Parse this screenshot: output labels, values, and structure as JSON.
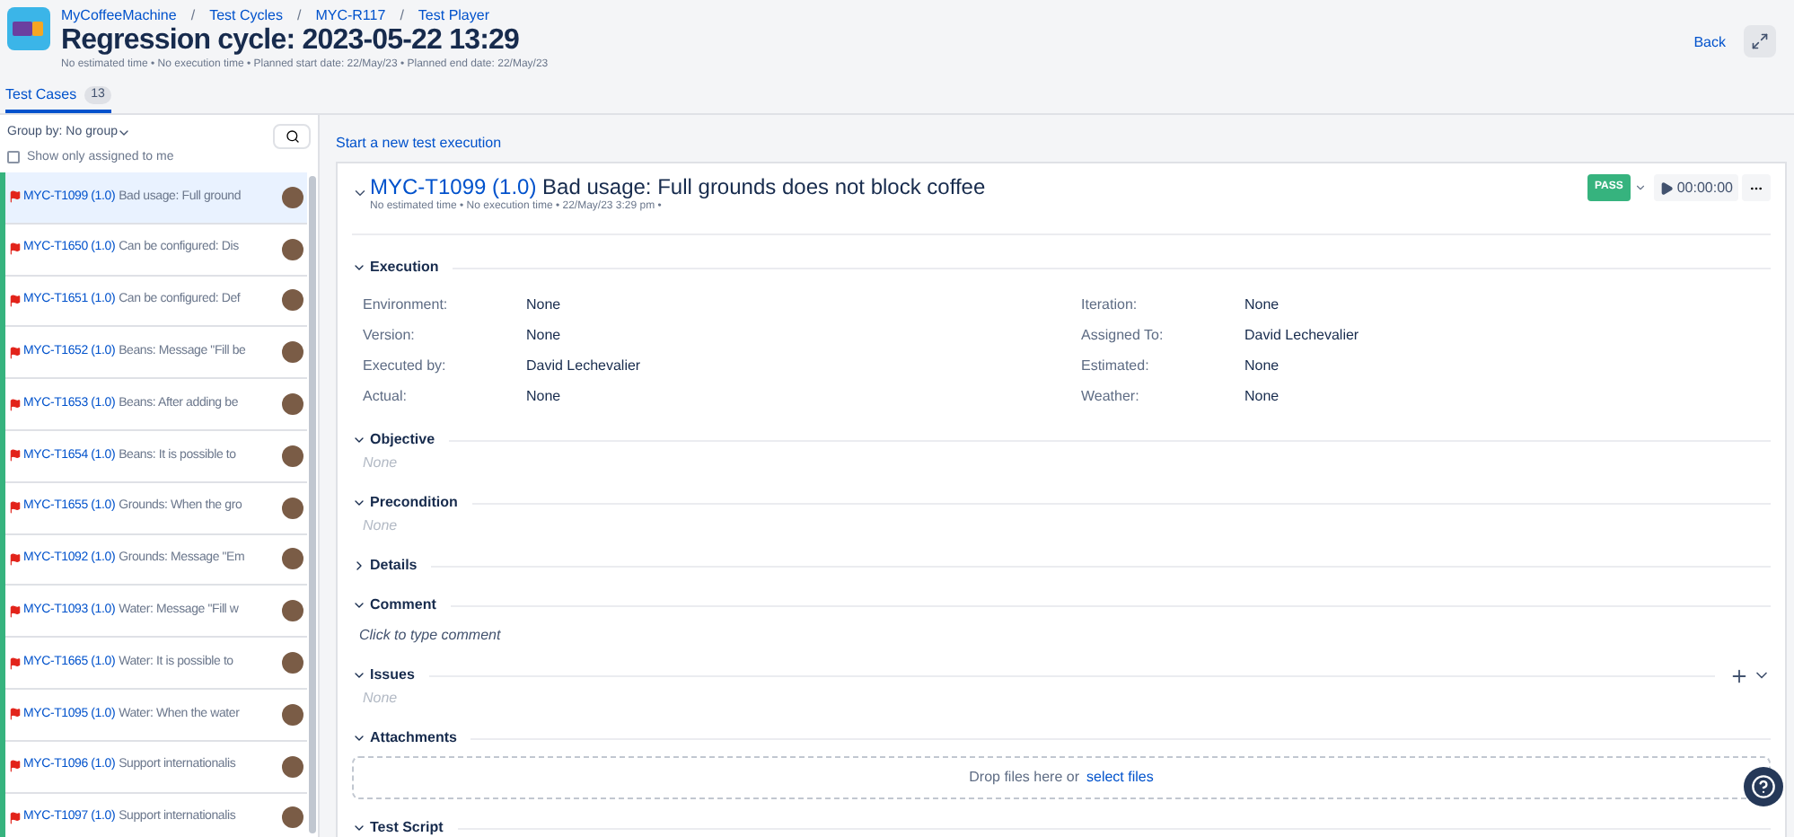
{
  "breadcrumbs": [
    "MyCoffeeMachine",
    "Test Cycles",
    "MYC-R117",
    "Test Player"
  ],
  "title": "Regression cycle: 2023-05-22 13:29",
  "breadcrumb_separator": "/",
  "meta": "No estimated time • No execution time • Planned start date: 22/May/23 • Planned end date: 22/May/23",
  "back": "Back",
  "tabs": [
    {
      "label": "Test Cases",
      "count": "13",
      "selected": true
    }
  ],
  "sidebar": {
    "group_by": "Group by: No group",
    "assigned_only": {
      "label": "Show only assigned to me",
      "checked": false
    },
    "items": [
      {
        "key": "MYC-T1099 (1.0)",
        "name": "Bad usage: Full ground",
        "selected": true
      },
      {
        "key": "MYC-T1650 (1.0)",
        "name": "Can be configured: Dis",
        "selected": false
      },
      {
        "key": "MYC-T1651 (1.0)",
        "name": "Can be configured: Def",
        "selected": false
      },
      {
        "key": "MYC-T1652 (1.0)",
        "name": "Beans: Message \"Fill be",
        "selected": false
      },
      {
        "key": "MYC-T1653 (1.0)",
        "name": "Beans: After adding be",
        "selected": false
      },
      {
        "key": "MYC-T1654 (1.0)",
        "name": "Beans: It is possible to",
        "selected": false
      },
      {
        "key": "MYC-T1655 (1.0)",
        "name": "Grounds: When the gro",
        "selected": false
      },
      {
        "key": "MYC-T1092 (1.0)",
        "name": "Grounds: Message \"Em",
        "selected": false
      },
      {
        "key": "MYC-T1093 (1.0)",
        "name": "Water: Message \"Fill w",
        "selected": false
      },
      {
        "key": "MYC-T1665 (1.0)",
        "name": "Water: It is possible to",
        "selected": false
      },
      {
        "key": "MYC-T1095 (1.0)",
        "name": "Water: When the water",
        "selected": false
      },
      {
        "key": "MYC-T1096 (1.0)",
        "name": "Support internationalis",
        "selected": false
      },
      {
        "key": "MYC-T1097 (1.0)",
        "name": "Support internationalis",
        "selected": false
      }
    ]
  },
  "new_execution": "Start a new test execution",
  "execution": {
    "key": "MYC-T1099 (1.0)",
    "name": "Bad usage: Full grounds does not block coffee",
    "meta": "No estimated time • No execution time • 22/May/23 3:29 pm •",
    "status": "PASS",
    "timer": "00:00:00",
    "sections": [
      {
        "kind": "fields",
        "title": "Execution",
        "expanded": true,
        "fields": [
          {
            "label": "Environment:",
            "value": "None"
          },
          {
            "label": "Iteration:",
            "value": "None"
          },
          {
            "label": "Version:",
            "value": "None"
          },
          {
            "label": "Assigned To:",
            "value": "David Lechevalier"
          },
          {
            "label": "Executed by:",
            "value": "David Lechevalier"
          },
          {
            "label": "Estimated:",
            "value": "None"
          },
          {
            "label": "Actual:",
            "value": "None"
          },
          {
            "label": "Weather:",
            "value": "None"
          }
        ]
      },
      {
        "kind": "empty",
        "title": "Objective",
        "expanded": true,
        "text": "None"
      },
      {
        "kind": "empty",
        "title": "Precondition",
        "expanded": true,
        "text": "None"
      },
      {
        "kind": "empty",
        "title": "Details",
        "expanded": false
      },
      {
        "kind": "comment",
        "title": "Comment",
        "expanded": true,
        "text": "Click to type comment"
      },
      {
        "kind": "issues",
        "title": "Issues",
        "expanded": true,
        "text": "None"
      },
      {
        "kind": "attachments",
        "title": "Attachments",
        "expanded": true,
        "text": "Drop files here or",
        "link": "select files"
      },
      {
        "kind": "empty",
        "title": "Test Script",
        "expanded": true
      }
    ]
  }
}
